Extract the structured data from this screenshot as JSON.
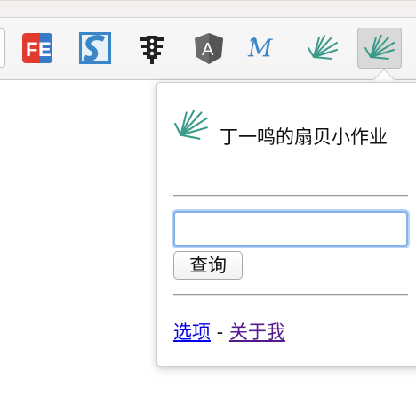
{
  "toolbar": {
    "extensions": [
      {
        "name": "fe-helper",
        "text": "FE",
        "color": "#e23a2e"
      },
      {
        "name": "s-extension",
        "text": "S",
        "color": "#3a86c8"
      },
      {
        "name": "traffic-light-extension",
        "color": "#222222"
      },
      {
        "name": "angular-extension",
        "text": "A",
        "color": "#5a5a5a"
      },
      {
        "name": "m-script-extension",
        "text": "𝓜",
        "color": "#3a86c8"
      },
      {
        "name": "shanbay-fan-extension",
        "color": "#3a9b8a"
      },
      {
        "name": "shanbay-fan-extension-active",
        "color": "#3a9b8a"
      }
    ]
  },
  "popup": {
    "title": "丁一鸣的扇贝小作业",
    "search": {
      "value": "",
      "placeholder": ""
    },
    "query_button": "查询",
    "links": {
      "options": "选项",
      "separator": " - ",
      "about": "关于我"
    }
  }
}
